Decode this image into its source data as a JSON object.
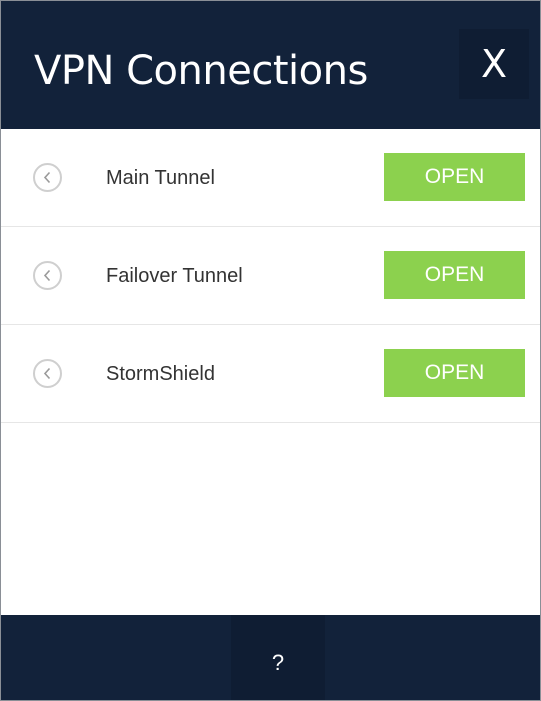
{
  "header": {
    "title": "VPN Connections",
    "close_label": "X"
  },
  "connections": [
    {
      "name": "Main Tunnel",
      "action_label": "OPEN"
    },
    {
      "name": "Failover Tunnel",
      "action_label": "OPEN"
    },
    {
      "name": "StormShield",
      "action_label": "OPEN"
    }
  ],
  "footer": {
    "help_label": "?"
  },
  "colors": {
    "header_bg": "#12223a",
    "open_button": "#8cd14e"
  },
  "icons": {
    "row_toggle": "chevron-left-circle-icon"
  }
}
